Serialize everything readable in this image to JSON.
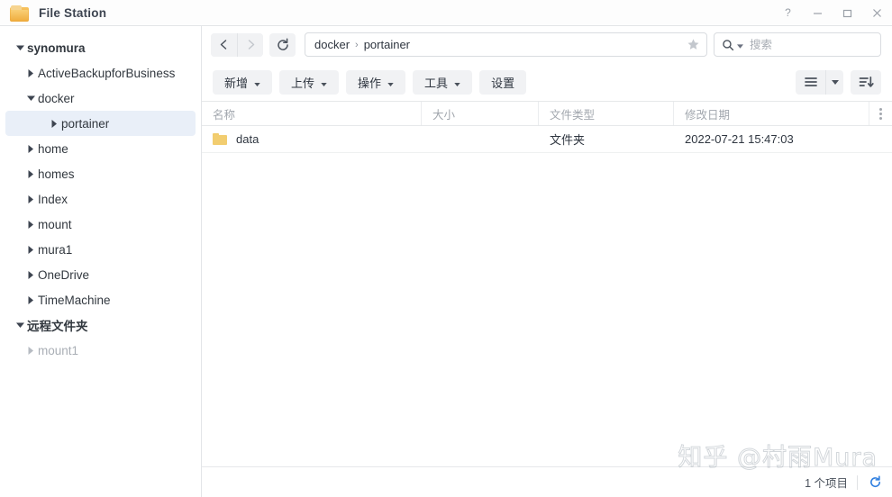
{
  "window": {
    "title": "File Station",
    "app_icon": "folder-icon",
    "controls": [
      {
        "name": "help",
        "glyph": "?"
      },
      {
        "name": "minimize",
        "glyph": "—"
      },
      {
        "name": "maximize",
        "glyph": "□"
      },
      {
        "name": "close",
        "glyph": "×"
      }
    ]
  },
  "sidebar": {
    "items": [
      {
        "label": "synomura",
        "depth": 0,
        "expanded": true,
        "root": true,
        "selected": false,
        "dim": false
      },
      {
        "label": "ActiveBackupforBusiness",
        "depth": 1,
        "expanded": false,
        "root": false,
        "selected": false,
        "dim": false
      },
      {
        "label": "docker",
        "depth": 1,
        "expanded": true,
        "root": false,
        "selected": false,
        "dim": false
      },
      {
        "label": "portainer",
        "depth": 2,
        "expanded": false,
        "root": false,
        "selected": true,
        "dim": false
      },
      {
        "label": "home",
        "depth": 1,
        "expanded": false,
        "root": false,
        "selected": false,
        "dim": false
      },
      {
        "label": "homes",
        "depth": 1,
        "expanded": false,
        "root": false,
        "selected": false,
        "dim": false
      },
      {
        "label": "Index",
        "depth": 1,
        "expanded": false,
        "root": false,
        "selected": false,
        "dim": false
      },
      {
        "label": "mount",
        "depth": 1,
        "expanded": false,
        "root": false,
        "selected": false,
        "dim": false
      },
      {
        "label": "mura1",
        "depth": 1,
        "expanded": false,
        "root": false,
        "selected": false,
        "dim": false
      },
      {
        "label": "OneDrive",
        "depth": 1,
        "expanded": false,
        "root": false,
        "selected": false,
        "dim": false
      },
      {
        "label": "TimeMachine",
        "depth": 1,
        "expanded": false,
        "root": false,
        "selected": false,
        "dim": false
      },
      {
        "label": "远程文件夹",
        "depth": 0,
        "expanded": true,
        "root": true,
        "selected": false,
        "dim": false
      },
      {
        "label": "mount1",
        "depth": 1,
        "expanded": false,
        "root": false,
        "selected": false,
        "dim": true
      }
    ]
  },
  "nav": {
    "back_icon": "chevron-left-icon",
    "forward_icon": "chevron-right-icon",
    "refresh_icon": "refresh-icon",
    "back_enabled": true,
    "forward_enabled": false
  },
  "address": {
    "breadcrumb": [
      "docker",
      "portainer"
    ],
    "separator": "›",
    "star_icon": "star-icon"
  },
  "search": {
    "placeholder": "搜索",
    "value": "",
    "icon": "search-icon",
    "caret_icon": "caret-down-icon"
  },
  "toolbar": {
    "buttons": [
      {
        "label": "新增",
        "caret": true
      },
      {
        "label": "上传",
        "caret": true
      },
      {
        "label": "操作",
        "caret": true
      },
      {
        "label": "工具",
        "caret": true
      },
      {
        "label": "设置",
        "caret": false
      }
    ],
    "view_icon": "list-view-icon",
    "view_caret_icon": "caret-down-icon",
    "sort_icon": "sort-descending-icon"
  },
  "table": {
    "columns": [
      "名称",
      "大小",
      "文件类型",
      "修改日期"
    ],
    "options_icon": "more-options-icon",
    "rows": [
      {
        "icon": "folder-icon",
        "name": "data",
        "size": "",
        "type": "文件夹",
        "date": "2022-07-21 15:47:03"
      }
    ]
  },
  "status": {
    "count_text": "1 个项目",
    "refresh_icon": "refresh-icon"
  },
  "watermark": {
    "text": "知乎 @村雨Mura"
  },
  "colors": {
    "accent": "#2f7fe0",
    "selection": "#e9eff8",
    "folder": "#f2cd70",
    "toolbar_button": "#f1f2f4"
  }
}
